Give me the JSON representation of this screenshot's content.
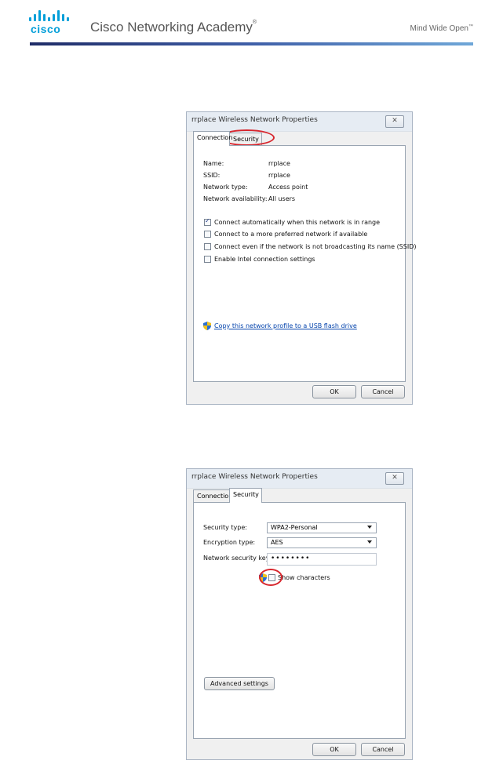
{
  "header": {
    "logo_text": "cisco",
    "title": "Cisco Networking Academy",
    "title_mark": "®",
    "tagline": "Mind Wide Open",
    "tagline_mark": "™"
  },
  "dialog_connection": {
    "title": "rrplace Wireless Network Properties",
    "close_label": "✕",
    "tabs": [
      "Connection",
      "Security"
    ],
    "fields": [
      {
        "label": "Name:",
        "value": "rrplace"
      },
      {
        "label": "SSID:",
        "value": "rrplace"
      },
      {
        "label": "Network type:",
        "value": "Access point"
      },
      {
        "label": "Network availability:",
        "value": "All users"
      }
    ],
    "options": [
      {
        "label": "Connect automatically when this network is in range",
        "checked": true
      },
      {
        "label": "Connect to a more preferred network if available",
        "checked": false
      },
      {
        "label": "Connect even if the network is not broadcasting its name (SSID)",
        "checked": false
      },
      {
        "label": "Enable Intel connection settings",
        "checked": false
      }
    ],
    "usb_link": "Copy this network profile to a USB flash drive",
    "ok_label": "OK",
    "cancel_label": "Cancel"
  },
  "dialog_security": {
    "title": "rrplace Wireless Network Properties",
    "close_label": "✕",
    "tabs": [
      "Connection",
      "Security"
    ],
    "security_type_label": "Security type:",
    "security_type_value": "WPA2-Personal",
    "encryption_type_label": "Encryption type:",
    "encryption_type_value": "AES",
    "network_key_label": "Network security key",
    "network_key_value": "••••••••",
    "show_characters_label": "Show characters",
    "advanced_settings_label": "Advanced settings",
    "ok_label": "OK",
    "cancel_label": "Cancel"
  },
  "colors": {
    "cisco_blue": "#049fd9",
    "highlight_red": "#d7262d",
    "link_blue": "#0645ad"
  },
  "icons": [
    "cisco-logo-bars",
    "close-icon",
    "shield-icon",
    "dropdown-arrow-icon",
    "checkmark-icon"
  ]
}
